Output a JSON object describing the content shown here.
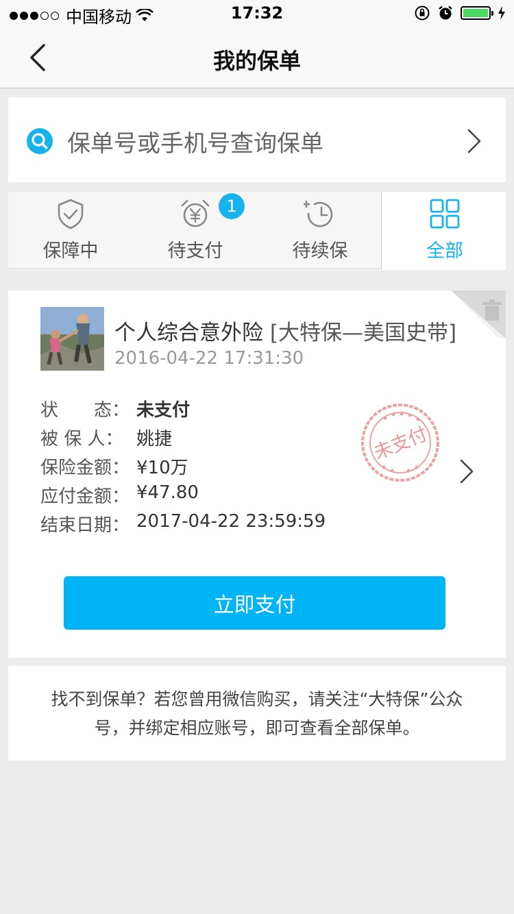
{
  "status_bar": {
    "carrier": "中国移动",
    "time": "17:32",
    "battery_color": "#4cd964"
  },
  "nav": {
    "title": "我的保单",
    "back_icon": "chevron-left-icon"
  },
  "search": {
    "placeholder": "保单号或手机号查询保单",
    "icon": "search-icon",
    "accent": "#17b1ec"
  },
  "tabs": [
    {
      "label": "保障中",
      "icon": "shield-check-icon",
      "active": false
    },
    {
      "label": "待支付",
      "icon": "alarm-yen-icon",
      "active": false,
      "badge": "1"
    },
    {
      "label": "待续保",
      "icon": "renew-clock-icon",
      "active": false
    },
    {
      "label": "全部",
      "icon": "grid-icon",
      "active": true
    }
  ],
  "policy": {
    "name": "个人综合意外险",
    "variant": "[大特保—美国史带]",
    "created": "2016-04-22 17:31:30",
    "rows": [
      {
        "label": "状　　态：",
        "value": "未支付",
        "bold": true
      },
      {
        "label": "被 保 人：",
        "value": "姚捷"
      },
      {
        "label": "保险金额：",
        "value": "¥10万"
      },
      {
        "label": "应付金额：",
        "value": "¥47.80"
      },
      {
        "label": "结束日期：",
        "value": "2017-04-22 23:59:59"
      }
    ],
    "stamp_text": "未支付",
    "pay_button": "立即支付",
    "pay_color": "#00b4f6"
  },
  "notice": {
    "line1": "找不到保单？若您曾用微信购买，请关注“大特保”公众",
    "line2": "号，并绑定相应账号，即可查看全部保单。"
  }
}
